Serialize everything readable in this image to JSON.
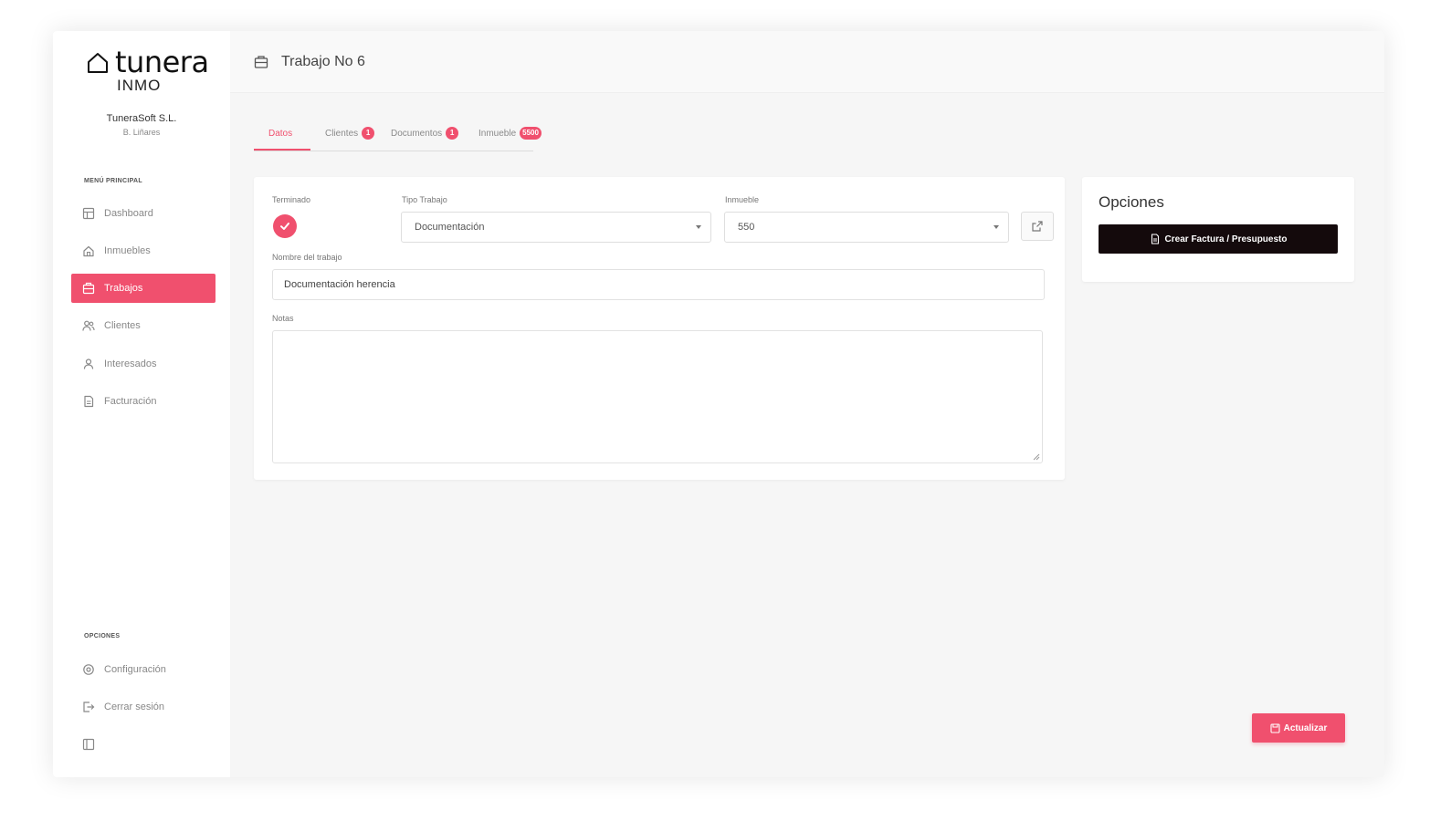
{
  "brand": {
    "name": "tunera",
    "sub": "INMO"
  },
  "company": {
    "name": "TuneraSoft S.L.",
    "user": "B. Liñares"
  },
  "sidebar": {
    "main_section_label": "MENÚ PRINCIPAL",
    "items": [
      {
        "label": "Dashboard",
        "icon": "dashboard-icon"
      },
      {
        "label": "Inmuebles",
        "icon": "home-icon"
      },
      {
        "label": "Trabajos",
        "icon": "briefcase-icon",
        "active": true
      },
      {
        "label": "Clientes",
        "icon": "users-icon"
      },
      {
        "label": "Interesados",
        "icon": "user-icon"
      },
      {
        "label": "Facturación",
        "icon": "invoice-icon"
      }
    ],
    "options_section_label": "OPCIONES",
    "option_items": [
      {
        "label": "Configuración",
        "icon": "gear-icon"
      },
      {
        "label": "Cerrar sesión",
        "icon": "logout-icon"
      }
    ],
    "collapse_icon": "sidebar-collapse-icon"
  },
  "header": {
    "title": "Trabajo No 6",
    "icon": "briefcase-icon"
  },
  "tabs": [
    {
      "label": "Datos",
      "active": true
    },
    {
      "label": "Clientes",
      "badge": "1"
    },
    {
      "label": "Documentos",
      "badge": "1"
    },
    {
      "label": "Inmueble",
      "badge": "5500"
    }
  ],
  "form": {
    "terminado_label": "Terminado",
    "terminado_checked": true,
    "tipo_trabajo_label": "Tipo Trabajo",
    "tipo_trabajo_value": "Documentación",
    "inmueble_label": "Inmueble",
    "inmueble_value": "550",
    "nombre_label": "Nombre del trabajo",
    "nombre_value": "Documentación herencia",
    "notas_label": "Notas",
    "notas_value": ""
  },
  "options_panel": {
    "title": "Opciones",
    "create_invoice_label": "Crear Factura / Presupuesto"
  },
  "actions": {
    "update_label": "Actualizar"
  },
  "colors": {
    "accent": "#f0506e",
    "dark_button": "#140a0c",
    "background": "#f6f6f6"
  }
}
